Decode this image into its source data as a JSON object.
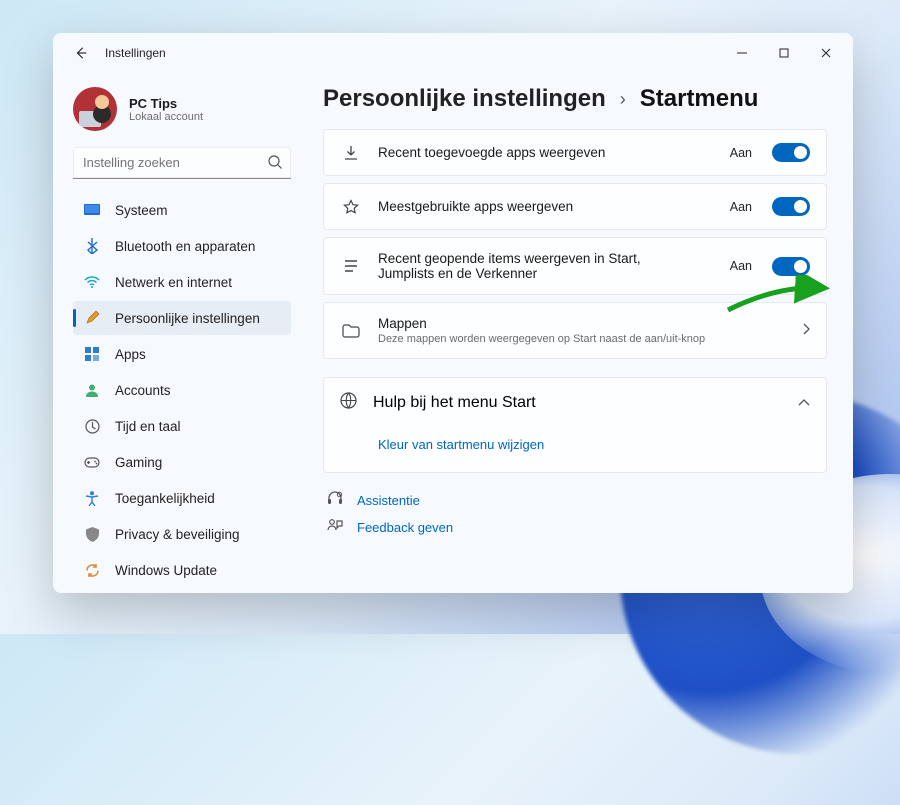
{
  "window": {
    "title": "Instellingen"
  },
  "profile": {
    "name": "PC Tips",
    "account_type": "Lokaal account"
  },
  "search": {
    "placeholder": "Instelling zoeken"
  },
  "nav": {
    "items": [
      {
        "label": "Systeem"
      },
      {
        "label": "Bluetooth en apparaten"
      },
      {
        "label": "Netwerk en internet"
      },
      {
        "label": "Persoonlijke instellingen"
      },
      {
        "label": "Apps"
      },
      {
        "label": "Accounts"
      },
      {
        "label": "Tijd en taal"
      },
      {
        "label": "Gaming"
      },
      {
        "label": "Toegankelijkheid"
      },
      {
        "label": "Privacy & beveiliging"
      },
      {
        "label": "Windows Update"
      }
    ]
  },
  "breadcrumb": {
    "parent": "Persoonlijke instellingen",
    "current": "Startmenu"
  },
  "settings": [
    {
      "label": "Recent toegevoegde apps weergeven",
      "state": "Aan"
    },
    {
      "label": "Meestgebruikte apps weergeven",
      "state": "Aan"
    },
    {
      "label": "Recent geopende items weergeven in Start, Jumplists en de Verkenner",
      "state": "Aan"
    }
  ],
  "folders": {
    "label": "Mappen",
    "sub": "Deze mappen worden weergegeven op Start naast de aan/uit-knop"
  },
  "help": {
    "title": "Hulp bij het menu Start",
    "link": "Kleur van startmenu wijzigen"
  },
  "footer": {
    "assist": "Assistentie",
    "feedback": "Feedback geven"
  }
}
